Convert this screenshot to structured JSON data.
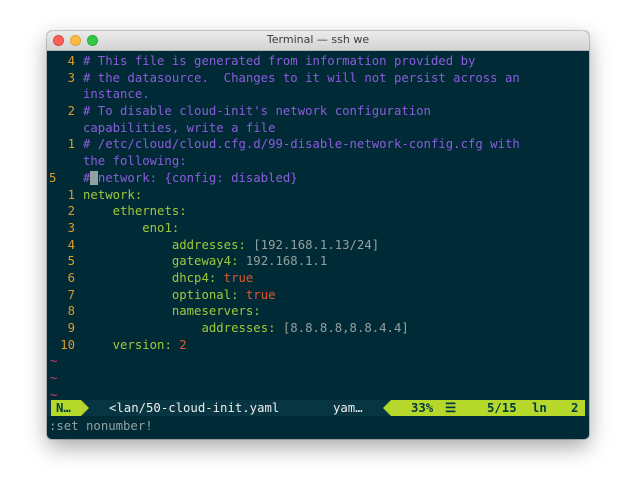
{
  "window": {
    "title": "Terminal — ssh we"
  },
  "editor": {
    "lines": [
      {
        "num": "4",
        "segments": [
          {
            "cls": "cmt",
            "text": "# This file is generated from information provided by"
          }
        ]
      },
      {
        "num": "3",
        "segments": [
          {
            "cls": "cmt",
            "text": "# the datasource.  Changes to it will not persist across an"
          }
        ]
      },
      {
        "num": "",
        "segments": [
          {
            "cls": "cmt",
            "text": "instance."
          }
        ]
      },
      {
        "num": "2",
        "segments": [
          {
            "cls": "cmt",
            "text": "# To disable cloud-init's network configuration"
          }
        ]
      },
      {
        "num": "",
        "segments": [
          {
            "cls": "cmt",
            "text": "capabilities, write a file"
          }
        ]
      },
      {
        "num": "1",
        "segments": [
          {
            "cls": "cmt",
            "text": "# /etc/cloud/cloud.cfg.d/99-disable-network-config.cfg with"
          }
        ]
      },
      {
        "num": "",
        "segments": [
          {
            "cls": "cmt",
            "text": "the following:"
          }
        ]
      },
      {
        "num": "5",
        "current": true,
        "segments": [
          {
            "cls": "cmt",
            "text": "#"
          },
          {
            "cls": "cursor",
            "text": " "
          },
          {
            "cls": "cmt",
            "text": "network: {config: disabled}"
          }
        ]
      },
      {
        "num": "1",
        "segments": [
          {
            "cls": "key",
            "text": "network:"
          }
        ]
      },
      {
        "num": "2",
        "segments": [
          {
            "cls": "nrm",
            "text": "    "
          },
          {
            "cls": "key",
            "text": "ethernets:"
          }
        ]
      },
      {
        "num": "3",
        "segments": [
          {
            "cls": "nrm",
            "text": "        "
          },
          {
            "cls": "key",
            "text": "eno1:"
          }
        ]
      },
      {
        "num": "4",
        "segments": [
          {
            "cls": "nrm",
            "text": "            "
          },
          {
            "cls": "key",
            "text": "addresses: "
          },
          {
            "cls": "str",
            "text": "[192.168.1.13/24]"
          }
        ]
      },
      {
        "num": "5",
        "segments": [
          {
            "cls": "nrm",
            "text": "            "
          },
          {
            "cls": "key",
            "text": "gateway4: "
          },
          {
            "cls": "str",
            "text": "192.168.1.1"
          }
        ]
      },
      {
        "num": "6",
        "segments": [
          {
            "cls": "nrm",
            "text": "            "
          },
          {
            "cls": "key",
            "text": "dhcp4: "
          },
          {
            "cls": "kw",
            "text": "true"
          }
        ]
      },
      {
        "num": "7",
        "segments": [
          {
            "cls": "nrm",
            "text": "            "
          },
          {
            "cls": "key",
            "text": "optional: "
          },
          {
            "cls": "kw",
            "text": "true"
          }
        ]
      },
      {
        "num": "8",
        "segments": [
          {
            "cls": "nrm",
            "text": "            "
          },
          {
            "cls": "key",
            "text": "nameservers:"
          }
        ]
      },
      {
        "num": "9",
        "segments": [
          {
            "cls": "nrm",
            "text": "                "
          },
          {
            "cls": "key",
            "text": "addresses: "
          },
          {
            "cls": "str",
            "text": "[8.8.8.8,8.8.4.4]"
          }
        ]
      },
      {
        "num": "10",
        "segments": [
          {
            "cls": "nrm",
            "text": "    "
          },
          {
            "cls": "key",
            "text": "version: "
          },
          {
            "cls": "kw",
            "text": "2"
          }
        ]
      }
    ],
    "tildes": [
      "~",
      "~",
      "~"
    ]
  },
  "statusline": {
    "mode": "N…",
    "file": "<lan/50-cloud-init.yaml",
    "filetype": "yam…",
    "percent": "33%",
    "menu_glyph": "☰",
    "position": "5/15",
    "col_glyph": "ln",
    "column": "2"
  },
  "cmdline": ":set nonumber!",
  "colors": {
    "background": "#002b36",
    "line_number": "#dc9b2a",
    "comment": "#8a5cdb",
    "key": "#9fc93a",
    "boolean": "#e0562e",
    "tilde": "#d33682",
    "statusline_accent": "#b5d82a"
  }
}
